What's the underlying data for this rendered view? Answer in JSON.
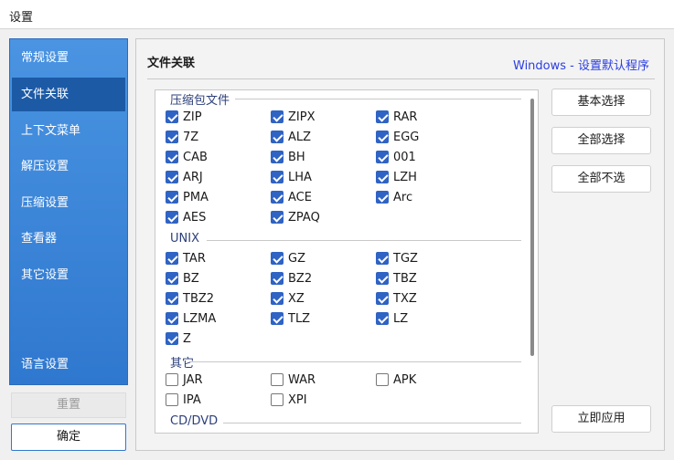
{
  "window": {
    "title": "设置"
  },
  "sidebar": {
    "items": [
      {
        "label": "常规设置",
        "active": false
      },
      {
        "label": "文件关联",
        "active": true
      },
      {
        "label": "上下文菜单",
        "active": false
      },
      {
        "label": "解压设置",
        "active": false
      },
      {
        "label": "压缩设置",
        "active": false
      },
      {
        "label": "查看器",
        "active": false
      },
      {
        "label": "其它设置",
        "active": false
      },
      {
        "label": "语言设置",
        "active": false
      }
    ],
    "reset_label": "重置",
    "ok_label": "确定"
  },
  "content": {
    "title": "文件关联",
    "link": "Windows - 设置默认程序"
  },
  "groups": [
    {
      "label": "压缩包文件",
      "items": [
        {
          "label": "ZIP",
          "checked": true
        },
        {
          "label": "ZIPX",
          "checked": true
        },
        {
          "label": "RAR",
          "checked": true
        },
        {
          "label": "7Z",
          "checked": true
        },
        {
          "label": "ALZ",
          "checked": true
        },
        {
          "label": "EGG",
          "checked": true
        },
        {
          "label": "CAB",
          "checked": true
        },
        {
          "label": "BH",
          "checked": true
        },
        {
          "label": "001",
          "checked": true
        },
        {
          "label": "ARJ",
          "checked": true
        },
        {
          "label": "LHA",
          "checked": true
        },
        {
          "label": "LZH",
          "checked": true
        },
        {
          "label": "PMA",
          "checked": true
        },
        {
          "label": "ACE",
          "checked": true
        },
        {
          "label": "Arc",
          "checked": true
        },
        {
          "label": "AES",
          "checked": true
        },
        {
          "label": "ZPAQ",
          "checked": true
        }
      ]
    },
    {
      "label": "UNIX",
      "items": [
        {
          "label": "TAR",
          "checked": true
        },
        {
          "label": "GZ",
          "checked": true
        },
        {
          "label": "TGZ",
          "checked": true
        },
        {
          "label": "BZ",
          "checked": true
        },
        {
          "label": "BZ2",
          "checked": true
        },
        {
          "label": "TBZ",
          "checked": true
        },
        {
          "label": "TBZ2",
          "checked": true
        },
        {
          "label": "XZ",
          "checked": true
        },
        {
          "label": "TXZ",
          "checked": true
        },
        {
          "label": "LZMA",
          "checked": true
        },
        {
          "label": "TLZ",
          "checked": true
        },
        {
          "label": "LZ",
          "checked": true
        },
        {
          "label": "Z",
          "checked": true
        }
      ]
    },
    {
      "label": "其它",
      "items": [
        {
          "label": "JAR",
          "checked": false
        },
        {
          "label": "WAR",
          "checked": false
        },
        {
          "label": "APK",
          "checked": false
        },
        {
          "label": "IPA",
          "checked": false
        },
        {
          "label": "XPI",
          "checked": false
        }
      ]
    },
    {
      "label": "CD/DVD",
      "items": []
    }
  ],
  "buttons": {
    "basic": "基本选择",
    "select_all": "全部选择",
    "select_none": "全部不选",
    "apply": "立即应用"
  },
  "colors": {
    "accent": "#2f63c4",
    "sidebar_top": "#4a94e2",
    "sidebar_active": "#1c5aa6",
    "link": "#2b3ee0"
  }
}
